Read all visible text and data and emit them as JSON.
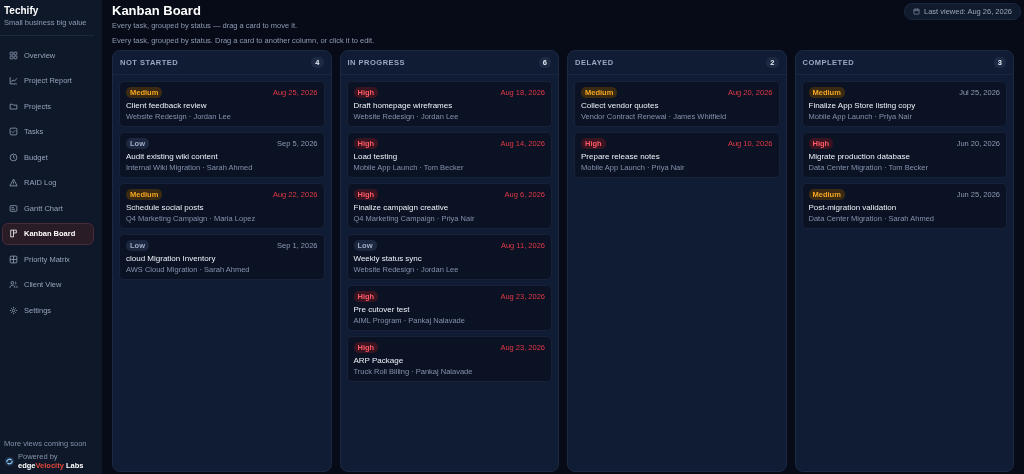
{
  "brand": {
    "name": "Techify",
    "tagline": "Small business big value"
  },
  "sidebar": {
    "items": [
      {
        "label": "Overview",
        "selected": false
      },
      {
        "label": "Project Report",
        "selected": false
      },
      {
        "label": "Projects",
        "selected": false
      },
      {
        "label": "Tasks",
        "selected": false
      },
      {
        "label": "Budget",
        "selected": false
      },
      {
        "label": "RAID Log",
        "selected": false
      },
      {
        "label": "Gantt Chart",
        "selected": false
      },
      {
        "label": "Kanban Board",
        "selected": true
      },
      {
        "label": "Priority Matrix",
        "selected": false
      },
      {
        "label": "Client View",
        "selected": false
      },
      {
        "label": "Settings",
        "selected": false
      }
    ],
    "footer_note": "More views coming soon",
    "powered_by": "Powered by",
    "vendor": [
      {
        "text": "edge",
        "accent": false
      },
      {
        "text": "Velocity",
        "accent": true
      },
      {
        "text": " Labs",
        "accent": false
      }
    ]
  },
  "header": {
    "title": "Kanban Board",
    "subtitle": "Every task, grouped by status — drag a card to move it.",
    "last_viewed": "Last viewed: Aug 26, 2026"
  },
  "description": "Every task, grouped by status. Drag a card to another column, or click it to edit.",
  "columns": [
    {
      "title": "NOT STARTED",
      "count": "4",
      "cards": [
        {
          "priority": "Medium",
          "kind": "medium",
          "due": "Aug 25, 2026",
          "overdue": true,
          "title": "Client feedback review",
          "meta": "Website Redesign · Jordan Lee"
        },
        {
          "priority": "Low",
          "kind": "low",
          "due": "Sep 5, 2026",
          "overdue": false,
          "title": "Audit existing wiki content",
          "meta": "Internal Wiki Migration · Sarah Ahmed"
        },
        {
          "priority": "Medium",
          "kind": "medium",
          "due": "Aug 22, 2026",
          "overdue": true,
          "title": "Schedule social posts",
          "meta": "Q4 Marketing Campaign · Maria Lopez"
        },
        {
          "priority": "Low",
          "kind": "low",
          "due": "Sep 1, 2026",
          "overdue": false,
          "title": "cloud Migration Inventory",
          "meta": "AWS Cloud Migration · Sarah Ahmed"
        }
      ]
    },
    {
      "title": "IN PROGRESS",
      "count": "6",
      "cards": [
        {
          "priority": "High",
          "kind": "high",
          "due": "Aug 18, 2026",
          "overdue": true,
          "title": "Draft homepage wireframes",
          "meta": "Website Redesign · Jordan Lee"
        },
        {
          "priority": "High",
          "kind": "high",
          "due": "Aug 14, 2026",
          "overdue": true,
          "title": "Load testing",
          "meta": "Mobile App Launch · Tom Becker"
        },
        {
          "priority": "High",
          "kind": "high",
          "due": "Aug 6, 2026",
          "overdue": true,
          "title": "Finalize campaign creative",
          "meta": "Q4 Marketing Campaign · Priya Nair"
        },
        {
          "priority": "Low",
          "kind": "low",
          "due": "Aug 11, 2026",
          "overdue": true,
          "title": "Weekly status sync",
          "meta": "Website Redesign · Jordan Lee"
        },
        {
          "priority": "High",
          "kind": "high",
          "due": "Aug 23, 2026",
          "overdue": true,
          "title": "Pre cutover test",
          "meta": "AIML Program · Pankaj Nalavade"
        },
        {
          "priority": "High",
          "kind": "high",
          "due": "Aug 23, 2026",
          "overdue": true,
          "title": "ARP Package",
          "meta": "Truck Roll Billing · Pankaj Nalavade"
        }
      ]
    },
    {
      "title": "DELAYED",
      "count": "2",
      "cards": [
        {
          "priority": "Medium",
          "kind": "medium",
          "due": "Aug 20, 2026",
          "overdue": true,
          "title": "Collect vendor quotes",
          "meta": "Vendor Contract Renewal · James Whitfield"
        },
        {
          "priority": "High",
          "kind": "high",
          "due": "Aug 10, 2026",
          "overdue": true,
          "title": "Prepare release notes",
          "meta": "Mobile App Launch · Priya Nair"
        }
      ]
    },
    {
      "title": "COMPLETED",
      "count": "3",
      "cards": [
        {
          "priority": "Medium",
          "kind": "medium",
          "due": "Jul 25, 2026",
          "overdue": false,
          "title": "Finalize App Store listing copy",
          "meta": "Mobile App Launch · Priya Nair"
        },
        {
          "priority": "High",
          "kind": "high",
          "due": "Jun 20, 2026",
          "overdue": false,
          "title": "Migrate production database",
          "meta": "Data Center Migration · Tom Becker"
        },
        {
          "priority": "Medium",
          "kind": "medium",
          "due": "Jun 25, 2026",
          "overdue": false,
          "title": "Post-migration validation",
          "meta": "Data Center Migration · Sarah Ahmed"
        }
      ]
    }
  ]
}
